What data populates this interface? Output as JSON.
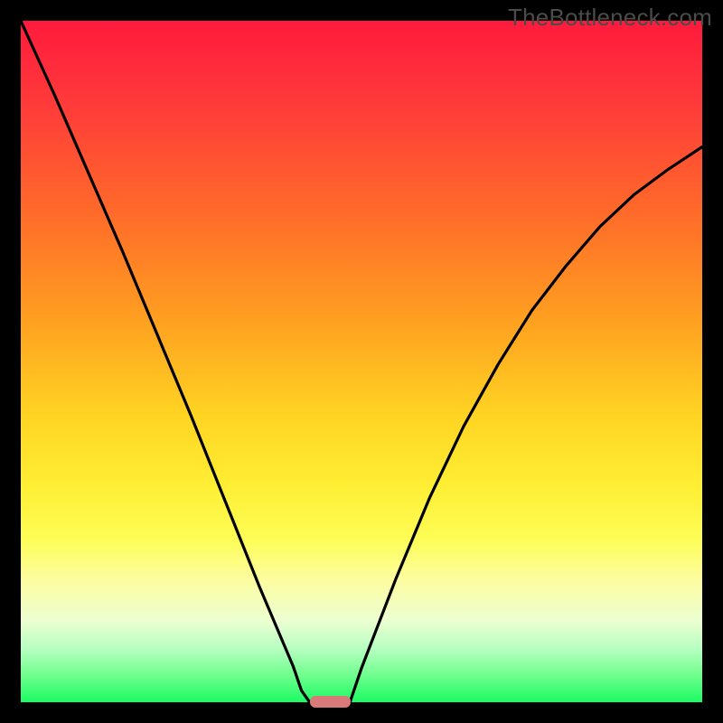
{
  "watermark": "TheBottleneck.com",
  "colors": {
    "frame": "#000000",
    "gradient_top": "#ff1a3d",
    "gradient_bottom": "#1bfb63",
    "curve": "#000000",
    "marker": "#d97a7a"
  },
  "chart_data": {
    "type": "line",
    "title": "",
    "xlabel": "",
    "ylabel": "",
    "xlim": [
      0,
      100
    ],
    "ylim": [
      0,
      100
    ],
    "grid": false,
    "x": [
      0,
      5,
      10,
      15,
      20,
      25,
      30,
      35,
      40,
      41.2,
      42.4,
      48.3,
      50,
      55,
      60,
      65,
      70,
      75,
      80,
      85,
      90,
      95,
      100
    ],
    "values": [
      100,
      89,
      77.5,
      66,
      54,
      42,
      29.5,
      17,
      5.2,
      1.7,
      0,
      0,
      5,
      18,
      30,
      40.5,
      49.5,
      57.5,
      64,
      69.8,
      74.5,
      78.2,
      81.5
    ],
    "marker": {
      "x_center": 45.4,
      "width_pct": 6
    },
    "annotations": []
  }
}
